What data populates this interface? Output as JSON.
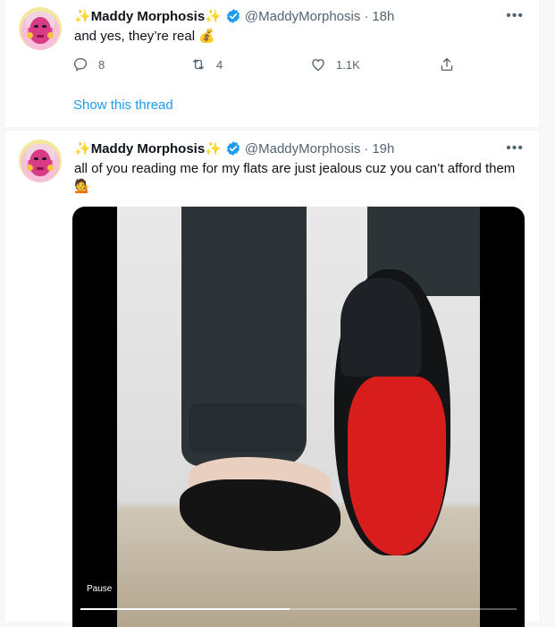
{
  "tweets": [
    {
      "display_name": "Maddy Morphosis",
      "sparkle": "✨",
      "handle": "@MaddyMorphosis",
      "separator": "·",
      "time": "18h",
      "text": "and yes, they’re real 💰",
      "more": "•••",
      "actions": {
        "reply_count": "8",
        "retweet_count": "4",
        "like_count": "1.1K"
      },
      "show_thread": "Show this thread"
    },
    {
      "display_name": "Maddy Morphosis",
      "sparkle": "✨",
      "handle": "@MaddyMorphosis",
      "separator": "·",
      "time": "19h",
      "text": "all of you reading me for my flats are just jealous cuz you can’t afford them",
      "emoji_line": "💁",
      "more": "•••",
      "video": {
        "pause_label": "Pause",
        "progress_fraction": 0.48
      }
    }
  ],
  "colors": {
    "accent": "#1d9bf0",
    "secondary_text": "#536471",
    "sparkle": "#f4b400"
  },
  "icons": [
    "reply-icon",
    "retweet-icon",
    "like-icon",
    "share-icon",
    "verified-badge-icon",
    "more-icon"
  ]
}
